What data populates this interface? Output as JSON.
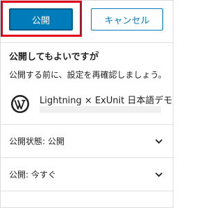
{
  "toolbar": {
    "publish_label": "公開",
    "cancel_label": "キャンセル"
  },
  "prepublish": {
    "title": "公開してもよいですか",
    "help": "?",
    "description": "公開する前に、設定を再確認しましょう。"
  },
  "site": {
    "name": "Lightning × ExUnit 日本語デモ",
    "icon": "wordpress-icon"
  },
  "panels": [
    {
      "label": "公開状態: 公開",
      "icon": "chevron-down-icon"
    },
    {
      "label": "公開: 今すぐ",
      "icon": "chevron-down-icon"
    }
  ],
  "colors": {
    "primary": "#007cba",
    "highlight": "#e0001b"
  }
}
